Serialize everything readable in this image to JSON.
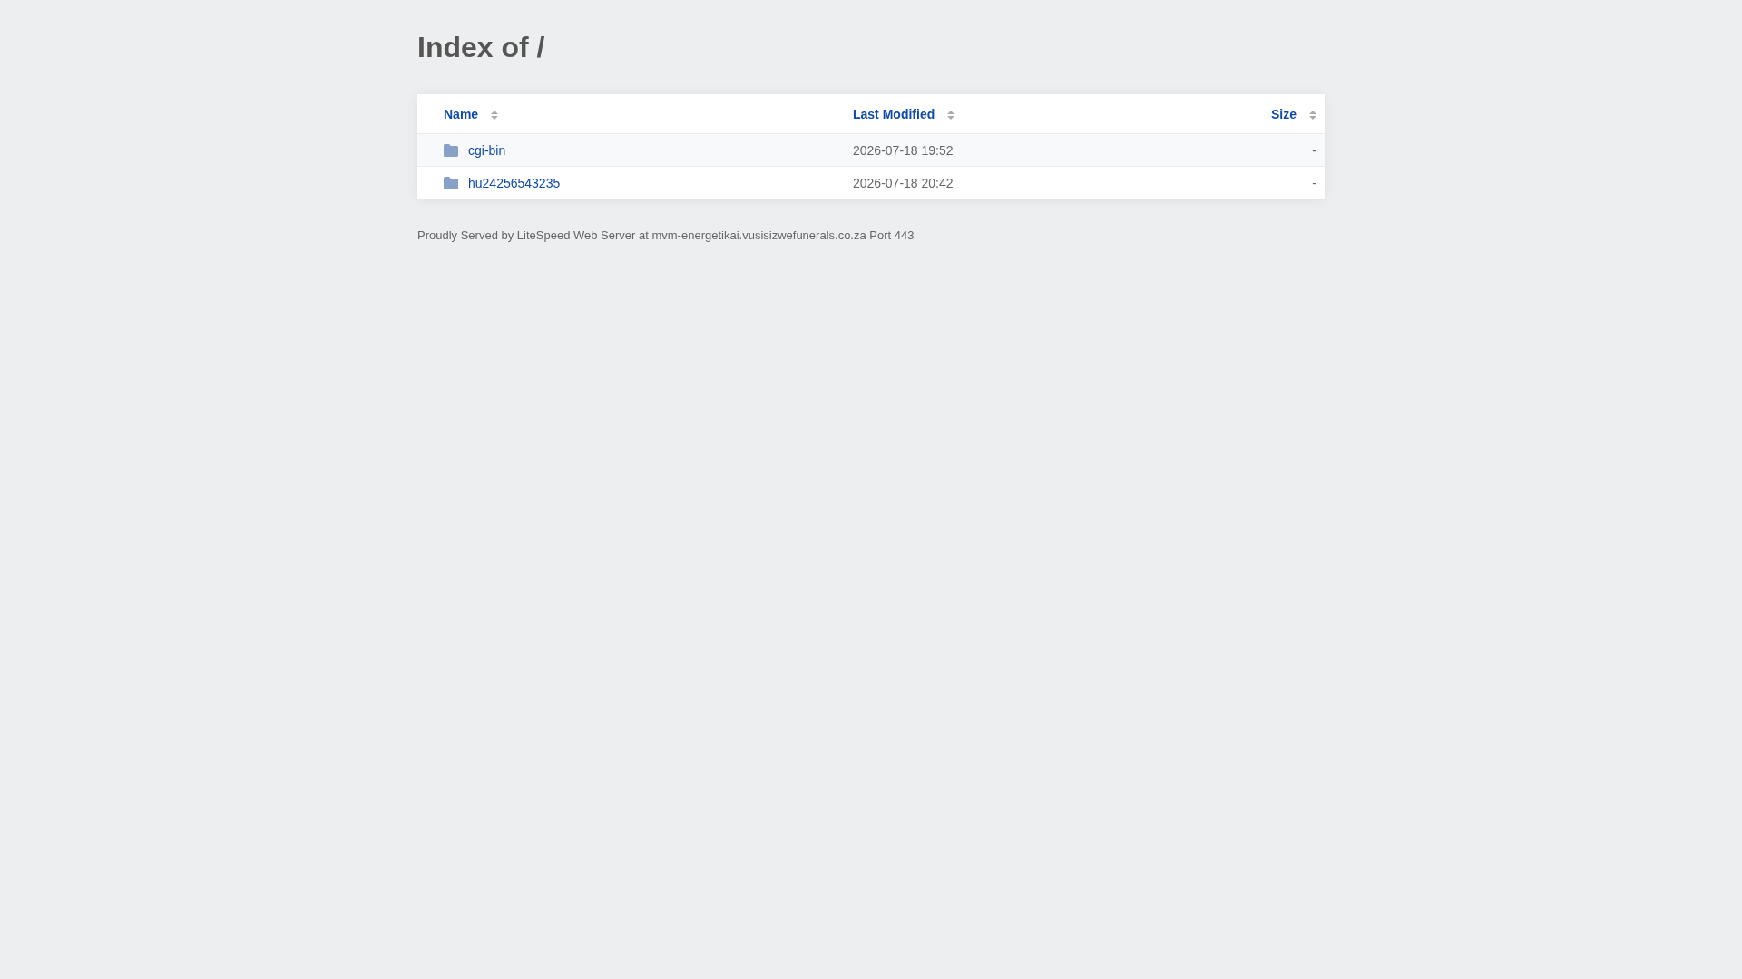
{
  "page": {
    "title": "Index of /"
  },
  "table": {
    "columns": [
      "Name",
      "Last Modified",
      "Size"
    ],
    "rows": [
      {
        "name": "cgi-bin",
        "last_modified": "2026-07-18 19:52",
        "size": "-"
      },
      {
        "name": "hu24256543235",
        "last_modified": "2026-07-18 20:42",
        "size": "-"
      }
    ]
  },
  "footer": {
    "text": "Proudly Served by LiteSpeed Web Server at mvm-energetikai.vusisizwefunerals.co.za Port 443"
  }
}
